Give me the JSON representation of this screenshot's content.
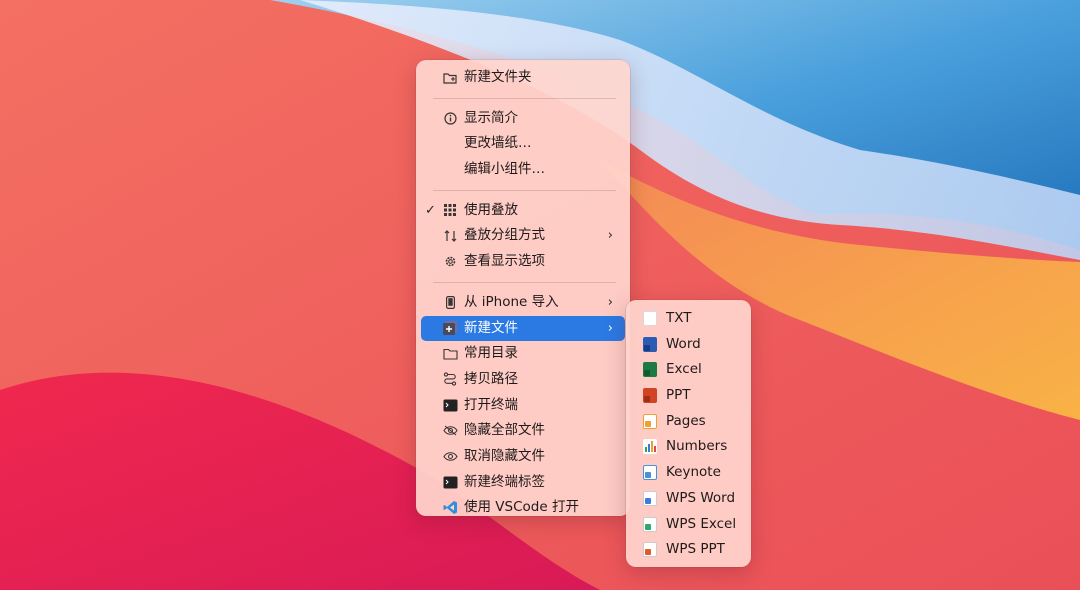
{
  "colors": {
    "highlight": "#2b7ae4",
    "menu_bg": "#ffd6ce",
    "wallpaper_red": "#ef5a5e",
    "wallpaper_blue": "#2a84c8",
    "wallpaper_orange": "#f7a83c"
  },
  "context_menu": {
    "new_folder": "新建文件夹",
    "get_info": "显示简介",
    "change_wallpaper": "更改墙纸…",
    "edit_widgets": "编辑小组件…",
    "use_stacks": "使用叠放",
    "group_stacks_by": "叠放分组方式",
    "show_view_options": "查看显示选项",
    "import_from_iphone": "从 iPhone 导入",
    "new_file": "新建文件",
    "common_dirs": "常用目录",
    "copy_path": "拷贝路径",
    "open_terminal": "打开终端",
    "hide_all_files": "隐藏全部文件",
    "unhide_files": "取消隐藏文件",
    "new_terminal_tab": "新建终端标签",
    "open_with_vscode": "使用 VSCode 打开",
    "checkmark": "✓",
    "chevron": "›"
  },
  "submenu": {
    "txt": "TXT",
    "word": "Word",
    "excel": "Excel",
    "ppt": "PPT",
    "pages": "Pages",
    "numbers": "Numbers",
    "keynote": "Keynote",
    "wps_word": "WPS Word",
    "wps_excel": "WPS Excel",
    "wps_ppt": "WPS PPT"
  }
}
